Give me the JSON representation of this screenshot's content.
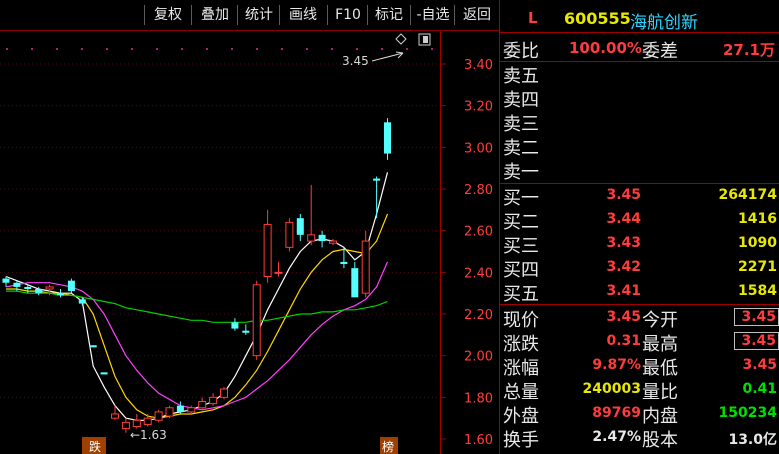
{
  "toolbar": {
    "buttons": [
      "复权",
      "叠加",
      "统计",
      "画线",
      "F10",
      "标记",
      "-自选",
      "返回"
    ]
  },
  "chart": {
    "price_axis": [
      "3.40",
      "3.20",
      "3.00",
      "2.80",
      "2.60",
      "2.40",
      "2.20",
      "2.00",
      "1.80",
      "1.60"
    ],
    "high_marker": "3.45",
    "low_marker": "1.63",
    "bottom_tag_left": "跌",
    "bottom_tag_right": "榜",
    "colors": {
      "up": "#ff3c3c",
      "down": "#54ffff",
      "ma1": "#ffffff",
      "ma2": "#ffd700",
      "ma3": "#ff40ff",
      "ma4": "#00d000"
    }
  },
  "chart_data": {
    "type": "line",
    "ylim": [
      1.6,
      3.45
    ],
    "candles_ohlc": [
      [
        2.37,
        2.38,
        2.33,
        2.35
      ],
      [
        2.35,
        2.36,
        2.31,
        2.33
      ],
      [
        2.33,
        2.34,
        2.3,
        2.32
      ],
      [
        2.32,
        2.33,
        2.29,
        2.3
      ],
      [
        2.32,
        2.34,
        2.29,
        2.33
      ],
      [
        2.3,
        2.32,
        2.28,
        2.29
      ],
      [
        2.36,
        2.37,
        2.3,
        2.31
      ],
      [
        2.27,
        2.28,
        2.24,
        2.25
      ],
      [
        2.05,
        2.05,
        2.04,
        2.04
      ],
      [
        1.92,
        1.92,
        1.91,
        1.91
      ],
      [
        1.7,
        1.76,
        1.69,
        1.72
      ],
      [
        1.65,
        1.7,
        1.63,
        1.68
      ],
      [
        1.66,
        1.72,
        1.65,
        1.69
      ],
      [
        1.67,
        1.72,
        1.66,
        1.7
      ],
      [
        1.69,
        1.74,
        1.68,
        1.73
      ],
      [
        1.71,
        1.76,
        1.7,
        1.75
      ],
      [
        1.76,
        1.78,
        1.72,
        1.73
      ],
      [
        1.73,
        1.76,
        1.72,
        1.75
      ],
      [
        1.75,
        1.8,
        1.74,
        1.78
      ],
      [
        1.77,
        1.82,
        1.76,
        1.8
      ],
      [
        1.8,
        1.85,
        1.79,
        1.84
      ],
      [
        2.16,
        2.18,
        2.12,
        2.13
      ],
      [
        2.12,
        2.15,
        2.1,
        2.11
      ],
      [
        2.0,
        2.36,
        1.98,
        2.34
      ],
      [
        2.38,
        2.7,
        2.35,
        2.63
      ],
      [
        2.4,
        2.45,
        2.38,
        2.4
      ],
      [
        2.52,
        2.66,
        2.5,
        2.64
      ],
      [
        2.66,
        2.68,
        2.55,
        2.58
      ],
      [
        2.55,
        2.82,
        2.53,
        2.58
      ],
      [
        2.58,
        2.6,
        2.52,
        2.55
      ],
      [
        2.54,
        2.56,
        2.53,
        2.55
      ],
      [
        2.45,
        2.52,
        2.42,
        2.44
      ],
      [
        2.42,
        2.45,
        2.33,
        2.28
      ],
      [
        2.3,
        2.6,
        2.28,
        2.55
      ],
      [
        2.85,
        2.86,
        2.66,
        2.84
      ],
      [
        3.12,
        3.14,
        2.94,
        2.97
      ]
    ],
    "series": [
      {
        "name": "",
        "values": [
          2.38,
          2.36,
          2.34,
          2.32,
          2.31,
          2.3,
          2.3,
          2.26,
          1.95,
          1.85,
          1.76,
          1.7,
          1.69,
          1.69,
          1.7,
          1.72,
          1.73,
          1.74,
          1.76,
          1.78,
          1.82,
          1.9,
          2.0,
          2.1,
          2.22,
          2.32,
          2.42,
          2.5,
          2.55,
          2.56,
          2.55,
          2.52,
          2.46,
          2.5,
          2.68,
          2.88
        ]
      },
      {
        "name": "",
        "values": [
          2.32,
          2.32,
          2.31,
          2.31,
          2.3,
          2.3,
          2.29,
          2.28,
          2.2,
          2.05,
          1.9,
          1.8,
          1.74,
          1.71,
          1.7,
          1.71,
          1.72,
          1.72,
          1.73,
          1.74,
          1.76,
          1.8,
          1.86,
          1.93,
          2.02,
          2.12,
          2.22,
          2.32,
          2.4,
          2.46,
          2.5,
          2.51,
          2.5,
          2.49,
          2.55,
          2.68
        ]
      },
      {
        "name": "",
        "values": [
          2.33,
          2.34,
          2.35,
          2.35,
          2.35,
          2.34,
          2.33,
          2.31,
          2.27,
          2.2,
          2.1,
          2.0,
          1.93,
          1.87,
          1.82,
          1.79,
          1.76,
          1.75,
          1.74,
          1.75,
          1.76,
          1.78,
          1.8,
          1.84,
          1.88,
          1.93,
          1.98,
          2.04,
          2.1,
          2.15,
          2.19,
          2.22,
          2.24,
          2.27,
          2.33,
          2.45
        ]
      },
      {
        "name": "",
        "values": [
          2.31,
          2.31,
          2.3,
          2.3,
          2.3,
          2.29,
          2.29,
          2.28,
          2.27,
          2.26,
          2.25,
          2.23,
          2.22,
          2.21,
          2.2,
          2.19,
          2.18,
          2.17,
          2.17,
          2.16,
          2.16,
          2.16,
          2.16,
          2.17,
          2.17,
          2.18,
          2.19,
          2.2,
          2.2,
          2.21,
          2.21,
          2.22,
          2.22,
          2.23,
          2.24,
          2.26
        ]
      }
    ]
  },
  "panel": {
    "code_prefix": "L",
    "code": "600555",
    "name": "海航创新",
    "weibi_label": "委比",
    "weibi_value": "100.00%",
    "weicha_label": "委差",
    "weicha_value": "27.1万",
    "sell": [
      {
        "label": "卖五",
        "price": "",
        "vol": ""
      },
      {
        "label": "卖四",
        "price": "",
        "vol": ""
      },
      {
        "label": "卖三",
        "price": "",
        "vol": ""
      },
      {
        "label": "卖二",
        "price": "",
        "vol": ""
      },
      {
        "label": "卖一",
        "price": "",
        "vol": ""
      }
    ],
    "buy": [
      {
        "label": "买一",
        "price": "3.45",
        "vol": "264174"
      },
      {
        "label": "买二",
        "price": "3.44",
        "vol": "1416"
      },
      {
        "label": "买三",
        "price": "3.43",
        "vol": "1090"
      },
      {
        "label": "买四",
        "price": "3.42",
        "vol": "2271"
      },
      {
        "label": "买五",
        "price": "3.41",
        "vol": "1584"
      }
    ],
    "stats": [
      {
        "l1": "现价",
        "v1": "3.45",
        "c1": "#ff3c3c",
        "l2": "今开",
        "v2": "3.45",
        "c2": "#ff3c3c",
        "boxed": true
      },
      {
        "l1": "涨跌",
        "v1": "0.31",
        "c1": "#ff3c3c",
        "l2": "最高",
        "v2": "3.45",
        "c2": "#ff3c3c",
        "boxed": true
      },
      {
        "l1": "涨幅",
        "v1": "9.87%",
        "c1": "#ff3c3c",
        "l2": "最低",
        "v2": "3.45",
        "c2": "#ff3c3c",
        "boxed": false
      },
      {
        "l1": "总量",
        "v1": "240003",
        "c1": "#e8e800",
        "l2": "量比",
        "v2": "0.41",
        "c2": "#00e000",
        "boxed": false
      },
      {
        "l1": "外盘",
        "v1": "89769",
        "c1": "#ff3c3c",
        "l2": "内盘",
        "v2": "150234",
        "c2": "#00e000",
        "boxed": false
      },
      {
        "l1": "换手",
        "v1": "2.47%",
        "c1": "#e8e8e8",
        "l2": "股本",
        "v2": "13.0亿",
        "c2": "#e8e8e8",
        "boxed": false
      }
    ]
  }
}
